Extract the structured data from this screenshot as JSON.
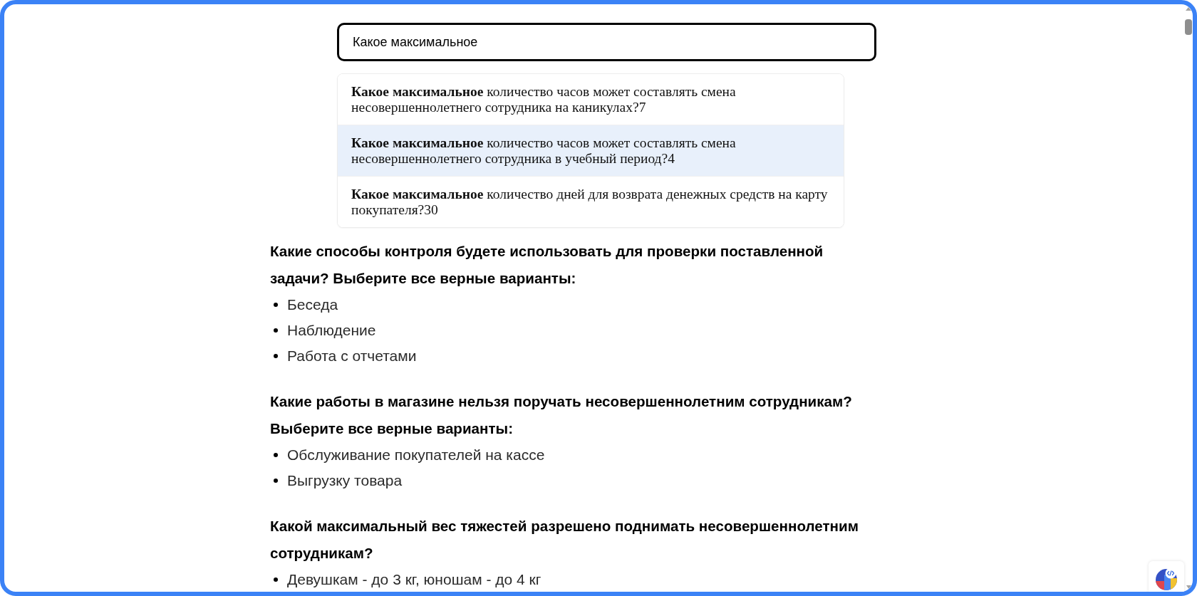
{
  "search": {
    "value": "Какое максимальное"
  },
  "suggestions": [
    {
      "text": "**Какое максимальное** количество часов может составлять смена несовершеннолетнего сотрудника на каникулах?7",
      "selected": false
    },
    {
      "text": "**Какое максимальное** количество часов может составлять смена несовершеннолетнего сотрудника в учебный период?4",
      "selected": true
    },
    {
      "text": "**Какое максимальное** количество дней для возврата денежных средств на карту покупателя?30",
      "selected": false
    }
  ],
  "questions": [
    {
      "title": "Какие способы контроля будете использовать для проверки поставленной задачи? Выберите все верные варианты:",
      "answers": [
        "Беседа",
        "Наблюдение",
        "Работа с отчетами"
      ]
    },
    {
      "title": "Какие работы в магазине нельзя поручать несовершеннолетним сотрудникам? Выберите все верные варианты:",
      "answers": [
        "Обслуживание покупателей на кассе",
        "Выгрузку товара"
      ]
    },
    {
      "title": "Какой максимальный вес тяжестей разрешено поднимать несовершеннолетним сотрудникам?",
      "answers": [
        "Девушкам - до 3 кг, юношам - до 4 кг"
      ]
    }
  ]
}
